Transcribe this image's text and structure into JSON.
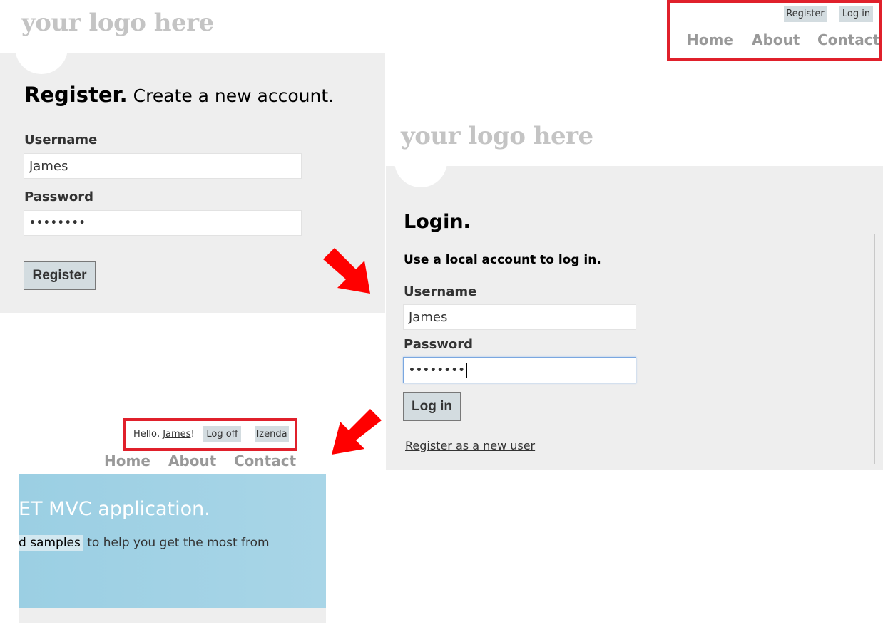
{
  "register_page": {
    "logo": "your logo here",
    "top_links": {
      "register": "Register",
      "login": "Log in"
    },
    "nav": {
      "home": "Home",
      "about": "About",
      "contact": "Contact"
    },
    "title_bold": "Register.",
    "title_rest": " Create a new account.",
    "username_label": "Username",
    "username_value": "James",
    "password_label": "Password",
    "password_value": "••••••••",
    "submit_label": "Register"
  },
  "login_page": {
    "logo": "your logo here",
    "title": "Login.",
    "subtitle": "Use a local account to log in.",
    "username_label": "Username",
    "username_value": "James",
    "password_label": "Password",
    "password_value": "••••••••",
    "submit_label": "Log in",
    "register_link": "Register as a new user"
  },
  "home_page": {
    "greeting_prefix": "Hello, ",
    "user": "James",
    "greeting_suffix": "!",
    "logoff": "Log off",
    "izenda": "Izenda",
    "nav": {
      "home": "Home",
      "about": "About",
      "contact": "Contact"
    },
    "hero_title": "ET MVC application.",
    "hero_highlight": "d samples",
    "hero_text": " to help you get the most from"
  },
  "colors": {
    "highlight_box": "#e0202b",
    "arrow": "#ff0000",
    "hero_blue": "#a6d3e6",
    "button_bg": "#d3dce0",
    "panel_gray": "#eeeeee"
  },
  "icons": {
    "arrow_1": "arrow-down-right-icon",
    "arrow_2": "arrow-down-left-icon"
  }
}
